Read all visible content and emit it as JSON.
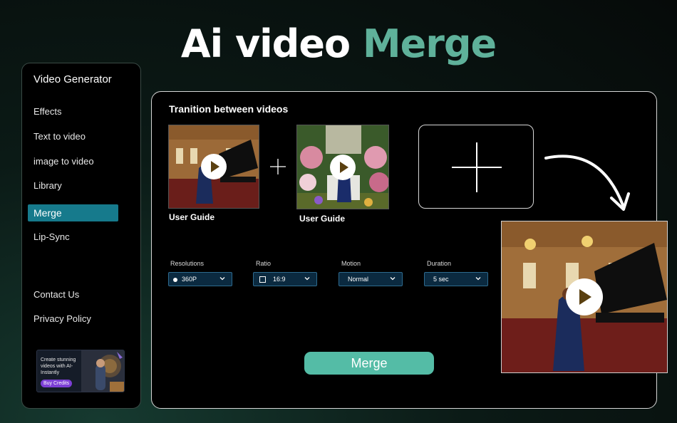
{
  "headline": {
    "white": "Ai video ",
    "green": "Merge"
  },
  "sidebar": {
    "title": "Video Generator",
    "items": [
      "Effects",
      "Text to video",
      "image to video",
      "Library",
      "Merge",
      "Lip-Sync"
    ],
    "footer": [
      "Contact Us",
      "Privacy Policy"
    ],
    "promo": {
      "text": "Create stunning videos with AI-Instantly",
      "button": "Buy Credits"
    }
  },
  "panel": {
    "title": "Tranition between videos",
    "thumbs": [
      {
        "label": "User Guide"
      },
      {
        "label": "User Guide"
      }
    ],
    "controls": [
      {
        "label": "Resolutions",
        "value": "360P"
      },
      {
        "label": "Ratio",
        "value": "16:9"
      },
      {
        "label": "Motion",
        "value": "Normal"
      },
      {
        "label": "Duration",
        "value": "5 sec"
      }
    ],
    "merge_button": "Merge"
  },
  "colors": {
    "accent_green": "#5fb19a",
    "active_item": "#167a8c",
    "merge_button": "#54bca6",
    "select_bg": "#0b2a40"
  },
  "icons": [
    "play-icon",
    "plus-icon",
    "add-video-icon",
    "chevron-down-icon",
    "curved-arrow-icon",
    "radio-dot-icon",
    "aspect-ratio-icon"
  ]
}
